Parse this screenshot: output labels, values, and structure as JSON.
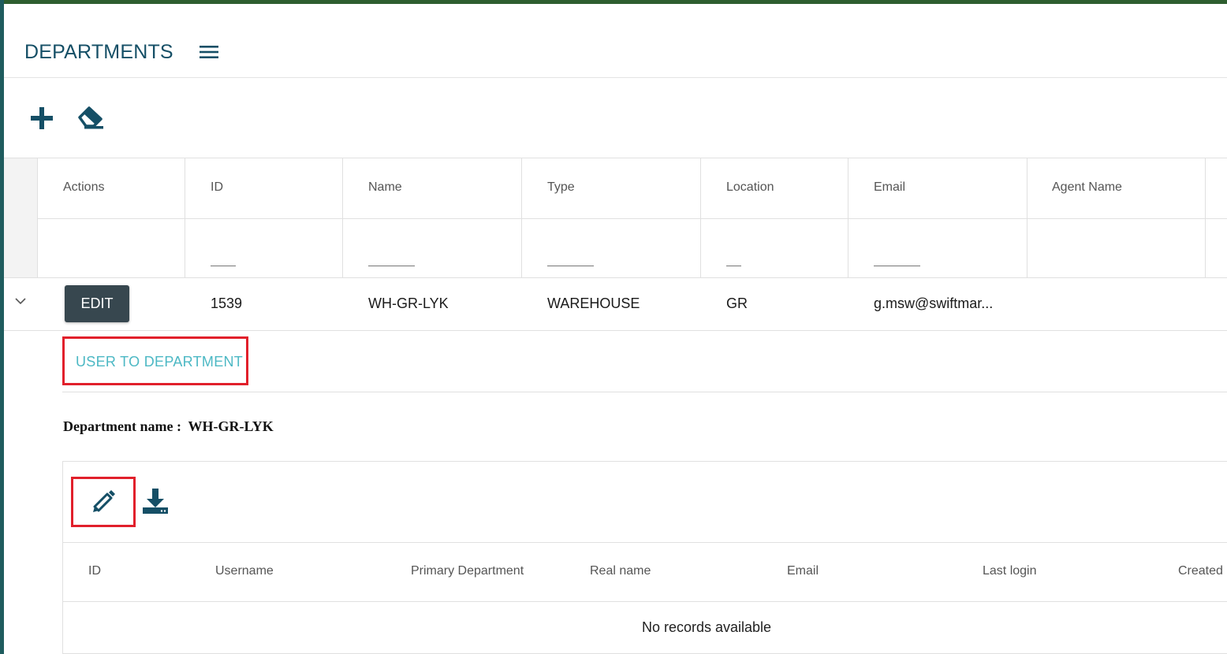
{
  "page": {
    "title": "DEPARTMENTS"
  },
  "colors": {
    "accent": "#154f66",
    "highlight": "#e1202b",
    "tab_text": "#4cb8c4",
    "edit_button": "#37474f"
  },
  "toolbar": {
    "icons": [
      "plus-icon",
      "eraser-icon"
    ]
  },
  "grid": {
    "columns": [
      "Actions",
      "ID",
      "Name",
      "Type",
      "Location",
      "Email",
      "Agent Name"
    ],
    "rows": [
      {
        "action_label": "EDIT",
        "id": "1539",
        "name": "WH-GR-LYK",
        "type": "WAREHOUSE",
        "location": "GR",
        "email": "g.msw@swiftmar...",
        "agent_name": ""
      }
    ]
  },
  "detail": {
    "tab_label": "USER TO DEPARTMENT",
    "dept_label": "Department name :",
    "dept_value": "WH-GR-LYK",
    "toolbar_icons": [
      "pencil-icon",
      "download-icon"
    ],
    "columns": [
      "ID",
      "Username",
      "Primary Department",
      "Real name",
      "Email",
      "Last login",
      "Created"
    ],
    "empty_message": "No records available"
  }
}
